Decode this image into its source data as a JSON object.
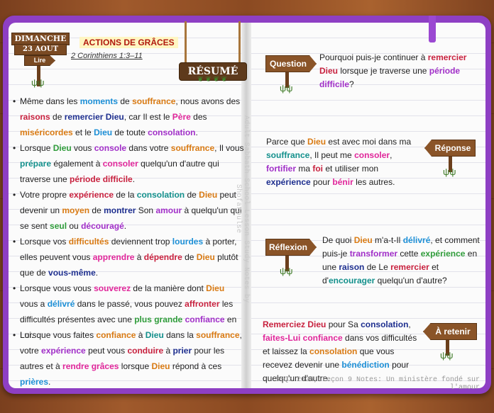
{
  "header": {
    "day": "DIMANCHE",
    "date": "23 AOUT",
    "read_label": "Lire",
    "title": "ACTIONS DE GRÂCES",
    "reference": "2 Corinthiens 1:3–11",
    "summary_sign": "RÉSUMÉ"
  },
  "left_page": {
    "bullets": [
      [
        {
          "t": "Même dans les ",
          "c": ""
        },
        {
          "t": "moments",
          "c": "blue"
        },
        {
          "t": " de ",
          "c": ""
        },
        {
          "t": "souffrance",
          "c": "orange"
        },
        {
          "t": ", nous avons des ",
          "c": ""
        },
        {
          "t": "raisons",
          "c": "red"
        },
        {
          "t": " de ",
          "c": ""
        },
        {
          "t": "remercier Dieu",
          "c": "navy"
        },
        {
          "t": ", car Il est le ",
          "c": ""
        },
        {
          "t": "Père",
          "c": "pink"
        },
        {
          "t": " des ",
          "c": ""
        },
        {
          "t": "miséricordes",
          "c": "orange"
        },
        {
          "t": " et le ",
          "c": ""
        },
        {
          "t": "Dieu",
          "c": "blue"
        },
        {
          "t": " de toute ",
          "c": ""
        },
        {
          "t": "consolation",
          "c": "purple"
        },
        {
          "t": ".",
          "c": ""
        }
      ],
      [
        {
          "t": "Lorsque ",
          "c": ""
        },
        {
          "t": "Dieu",
          "c": "green"
        },
        {
          "t": " vous ",
          "c": ""
        },
        {
          "t": "console",
          "c": "purple"
        },
        {
          "t": " dans votre ",
          "c": ""
        },
        {
          "t": "souffrance",
          "c": "orange"
        },
        {
          "t": ", Il vous ",
          "c": ""
        },
        {
          "t": "prépare",
          "c": "teal"
        },
        {
          "t": " également à ",
          "c": ""
        },
        {
          "t": "consoler",
          "c": "pink"
        },
        {
          "t": " quelqu'un d'autre qui traverse une ",
          "c": ""
        },
        {
          "t": "période difficile",
          "c": "red"
        },
        {
          "t": ".",
          "c": ""
        }
      ],
      [
        {
          "t": "Votre propre ",
          "c": ""
        },
        {
          "t": "expérience",
          "c": "red"
        },
        {
          "t": " de la ",
          "c": ""
        },
        {
          "t": "consolation",
          "c": "teal"
        },
        {
          "t": " de ",
          "c": ""
        },
        {
          "t": "Dieu",
          "c": "orange"
        },
        {
          "t": " peut devenir un ",
          "c": ""
        },
        {
          "t": "moyen",
          "c": "orange"
        },
        {
          "t": " de ",
          "c": ""
        },
        {
          "t": "montrer",
          "c": "navy"
        },
        {
          "t": " Son ",
          "c": ""
        },
        {
          "t": "amour",
          "c": "purple"
        },
        {
          "t": " à quelqu'un qui se sent ",
          "c": ""
        },
        {
          "t": "seul",
          "c": "green"
        },
        {
          "t": " ou ",
          "c": ""
        },
        {
          "t": "découragé",
          "c": "purple"
        },
        {
          "t": ".",
          "c": ""
        }
      ],
      [
        {
          "t": "Lorsque vos ",
          "c": ""
        },
        {
          "t": "difficultés",
          "c": "orange"
        },
        {
          "t": " deviennent trop ",
          "c": ""
        },
        {
          "t": "lourdes",
          "c": "blue"
        },
        {
          "t": " à porter, elles peuvent vous ",
          "c": ""
        },
        {
          "t": "apprendre",
          "c": "pink"
        },
        {
          "t": " à ",
          "c": ""
        },
        {
          "t": "dépendre",
          "c": "red"
        },
        {
          "t": " de ",
          "c": ""
        },
        {
          "t": "Dieu",
          "c": "orange"
        },
        {
          "t": " plutôt que de ",
          "c": ""
        },
        {
          "t": "vous-même",
          "c": "navy"
        },
        {
          "t": ".",
          "c": ""
        }
      ],
      [
        {
          "t": "Lorsque vous vous ",
          "c": ""
        },
        {
          "t": "souverez",
          "c": "pink"
        },
        {
          "t": " de la manière dont ",
          "c": ""
        },
        {
          "t": "Dieu",
          "c": "orange"
        },
        {
          "t": " vous a ",
          "c": ""
        },
        {
          "t": "délivré",
          "c": "blue"
        },
        {
          "t": " dans le passé, vous pouvez ",
          "c": ""
        },
        {
          "t": "affronter",
          "c": "red"
        },
        {
          "t": " les difficultés présentes avec une ",
          "c": ""
        },
        {
          "t": "plus grande",
          "c": "green"
        },
        {
          "t": " ",
          "c": ""
        },
        {
          "t": "confiance",
          "c": "purple"
        },
        {
          "t": " en Lui.",
          "c": ""
        }
      ],
      [
        {
          "t": "Lorsque vous faites ",
          "c": ""
        },
        {
          "t": "confiance",
          "c": "orange"
        },
        {
          "t": " à ",
          "c": ""
        },
        {
          "t": "Dieu",
          "c": "teal"
        },
        {
          "t": " dans la ",
          "c": ""
        },
        {
          "t": "souffrance",
          "c": "orange"
        },
        {
          "t": ", votre ",
          "c": ""
        },
        {
          "t": "expérience",
          "c": "purple"
        },
        {
          "t": " peut vous ",
          "c": ""
        },
        {
          "t": "conduire",
          "c": "red"
        },
        {
          "t": " à ",
          "c": ""
        },
        {
          "t": "prier",
          "c": "navy"
        },
        {
          "t": " pour les autres et à ",
          "c": ""
        },
        {
          "t": "rendre grâces",
          "c": "pink"
        },
        {
          "t": " lorsque ",
          "c": ""
        },
        {
          "t": "Dieu",
          "c": "orange"
        },
        {
          "t": " répond à ces ",
          "c": ""
        },
        {
          "t": "prières",
          "c": "blue"
        },
        {
          "t": ".",
          "c": ""
        }
      ]
    ]
  },
  "side_text": "Adult Sabbath School Lesson Study Notes by Shofarpulse",
  "right_page": {
    "question_label": "Question",
    "question": [
      {
        "t": "Pourquoi puis-je continuer à ",
        "c": ""
      },
      {
        "t": "remercier Dieu",
        "c": "red"
      },
      {
        "t": " lorsque je traverse une ",
        "c": ""
      },
      {
        "t": "période difficile",
        "c": "purple"
      },
      {
        "t": "?",
        "c": ""
      }
    ],
    "answer_label": "Réponse",
    "answer": [
      {
        "t": "Parce que ",
        "c": ""
      },
      {
        "t": "Dieu",
        "c": "orange"
      },
      {
        "t": " est avec moi dans ma ",
        "c": ""
      },
      {
        "t": "souffrance",
        "c": "teal"
      },
      {
        "t": ", Il peut me ",
        "c": ""
      },
      {
        "t": "consoler",
        "c": "pink"
      },
      {
        "t": ", ",
        "c": ""
      },
      {
        "t": "fortifier",
        "c": "purple"
      },
      {
        "t": " ma ",
        "c": ""
      },
      {
        "t": "foi",
        "c": "red"
      },
      {
        "t": " et utiliser mon ",
        "c": ""
      },
      {
        "t": "expérience",
        "c": "navy"
      },
      {
        "t": " pour ",
        "c": ""
      },
      {
        "t": "bénir",
        "c": "pink"
      },
      {
        "t": " les autres.",
        "c": ""
      }
    ],
    "reflection_label": "Réflexion",
    "reflection": [
      {
        "t": "De quoi ",
        "c": ""
      },
      {
        "t": "Dieu",
        "c": "orange"
      },
      {
        "t": " m'a-t-Il ",
        "c": ""
      },
      {
        "t": "délivré",
        "c": "blue"
      },
      {
        "t": ", et comment puis-je ",
        "c": ""
      },
      {
        "t": "transformer",
        "c": "purple"
      },
      {
        "t": " cette ",
        "c": ""
      },
      {
        "t": "expérience",
        "c": "green"
      },
      {
        "t": " en une ",
        "c": ""
      },
      {
        "t": "raison",
        "c": "navy"
      },
      {
        "t": " de Le ",
        "c": ""
      },
      {
        "t": "remercier",
        "c": "red"
      },
      {
        "t": " et d'",
        "c": ""
      },
      {
        "t": "encourager",
        "c": "teal"
      },
      {
        "t": " quelqu'un d'autre?",
        "c": ""
      }
    ],
    "remember_label": "À retenir",
    "remember": [
      {
        "t": "Remerciez Dieu",
        "c": "red"
      },
      {
        "t": " pour Sa ",
        "c": ""
      },
      {
        "t": "consolation",
        "c": "navy"
      },
      {
        "t": ", ",
        "c": ""
      },
      {
        "t": "faites-Lui confiance",
        "c": "pink"
      },
      {
        "t": " dans vos difficultés et laissez la ",
        "c": ""
      },
      {
        "t": "consolation",
        "c": "orange"
      },
      {
        "t": " que vous recevez devenir une ",
        "c": ""
      },
      {
        "t": "bénédiction",
        "c": "blue"
      },
      {
        "t": " pour quelqu'un d'autre.",
        "c": ""
      }
    ],
    "footer": "SSQ3 2026, Leçon 9 Notes: Un ministère fondé sur l'amour"
  },
  "colors": {
    "notebook": "#8e3fc4",
    "title": "#b0190e",
    "sign_wood": "#7a4a23"
  }
}
